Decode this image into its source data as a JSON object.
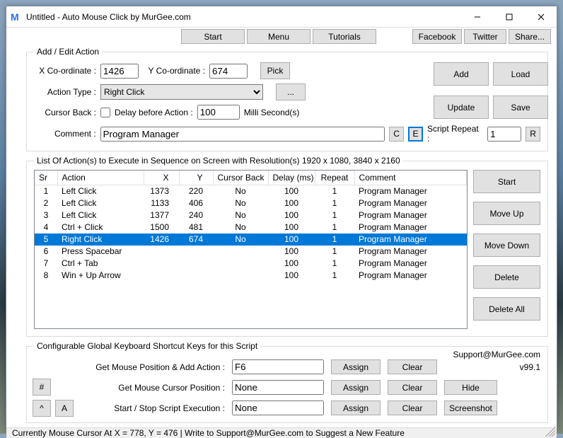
{
  "window": {
    "title": "Untitled - Auto Mouse Click by MurGee.com"
  },
  "topButtons": {
    "start": "Start",
    "menu": "Menu",
    "tutorials": "Tutorials",
    "facebook": "Facebook",
    "twitter": "Twitter",
    "share": "Share..."
  },
  "addEdit": {
    "legend": "Add / Edit Action",
    "xLabel": "X Co-ordinate :",
    "xValue": "1426",
    "yLabel": "Y Co-ordinate :",
    "yValue": "674",
    "pick": "Pick",
    "actionTypeLabel": "Action Type :",
    "actionType": "Right Click",
    "dots": "...",
    "cursorBackLabel": "Cursor Back :",
    "cursorBack": false,
    "delayLabel": "Delay before Action :",
    "delayValue": "100",
    "delayUnits": "Milli Second(s)",
    "commentLabel": "Comment :",
    "commentValue": "Program Manager",
    "c": "C",
    "e": "E",
    "repeatLabel": "Script Repeat :",
    "repeatValue": "1",
    "r": "R"
  },
  "sideButtons": {
    "add": "Add",
    "load": "Load",
    "update": "Update",
    "save": "Save"
  },
  "listHeader": "List Of Action(s) to Execute in Sequence on Screen with Resolution(s) 1920 x 1080, 3840 x 2160",
  "columns": {
    "sr": "Sr",
    "action": "Action",
    "x": "X",
    "y": "Y",
    "cursorBack": "Cursor Back",
    "delay": "Delay (ms)",
    "repeat": "Repeat",
    "comment": "Comment"
  },
  "rows": [
    {
      "sr": "1",
      "action": "Left Click",
      "x": "1373",
      "y": "220",
      "cb": "No",
      "delay": "100",
      "repeat": "1",
      "comment": "Program Manager"
    },
    {
      "sr": "2",
      "action": "Left Click",
      "x": "1133",
      "y": "406",
      "cb": "No",
      "delay": "100",
      "repeat": "1",
      "comment": "Program Manager"
    },
    {
      "sr": "3",
      "action": "Left Click",
      "x": "1377",
      "y": "240",
      "cb": "No",
      "delay": "100",
      "repeat": "1",
      "comment": "Program Manager"
    },
    {
      "sr": "4",
      "action": "Ctrl + Click",
      "x": "1500",
      "y": "481",
      "cb": "No",
      "delay": "100",
      "repeat": "1",
      "comment": "Program Manager"
    },
    {
      "sr": "5",
      "action": "Right Click",
      "x": "1426",
      "y": "674",
      "cb": "No",
      "delay": "100",
      "repeat": "1",
      "comment": "Program Manager",
      "selected": true
    },
    {
      "sr": "6",
      "action": "Press Spacebar",
      "x": "",
      "y": "",
      "cb": "",
      "delay": "100",
      "repeat": "1",
      "comment": "Program Manager"
    },
    {
      "sr": "7",
      "action": "Ctrl + Tab",
      "x": "",
      "y": "",
      "cb": "",
      "delay": "100",
      "repeat": "1",
      "comment": "Program Manager"
    },
    {
      "sr": "8",
      "action": "Win + Up Arrow",
      "x": "",
      "y": "",
      "cb": "",
      "delay": "100",
      "repeat": "1",
      "comment": "Program Manager"
    }
  ],
  "listButtons": {
    "start": "Start",
    "moveUp": "Move Up",
    "moveDown": "Move Down",
    "delete": "Delete",
    "deleteAll": "Delete All"
  },
  "shortcuts": {
    "legend": "Configurable Global Keyboard Shortcut Keys for this Script",
    "support": "Support@MurGee.com",
    "rows": [
      {
        "label": "Get Mouse Position & Add Action :",
        "value": "F6"
      },
      {
        "label": "Get Mouse Cursor Position :",
        "value": "None"
      },
      {
        "label": "Start / Stop Script Execution :",
        "value": "None"
      }
    ],
    "assign": "Assign",
    "clear": "Clear",
    "version": "v99.1",
    "hide": "Hide",
    "screenshot": "Screenshot",
    "hash": "#",
    "caret": "^",
    "a": "A"
  },
  "status": "Currently Mouse Cursor At X = 778, Y = 476 | Write to Support@MurGee.com to Suggest a New Feature"
}
